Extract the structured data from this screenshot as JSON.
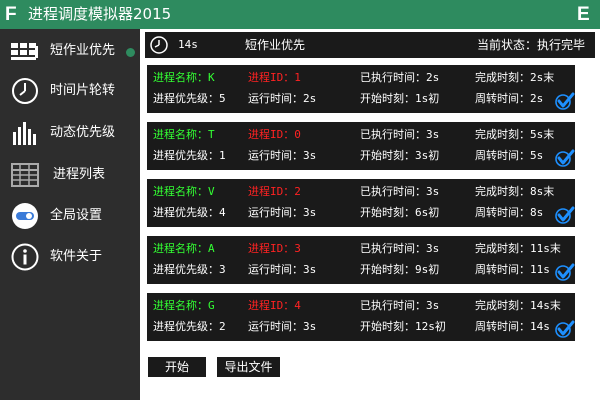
{
  "window": {
    "logo_letter": "F",
    "title": "进程调度模拟器2015",
    "corner_letter": "E"
  },
  "sidebar": {
    "items": [
      {
        "label": "短作业优先",
        "icon": "sjf-icon",
        "active": true
      },
      {
        "label": "时间片轮转",
        "icon": "clock-icon",
        "active": false
      },
      {
        "label": "动态优先级",
        "icon": "bar-chart-icon",
        "active": false
      },
      {
        "label": "进程列表",
        "icon": "table-icon",
        "active": false
      },
      {
        "label": "全局设置",
        "icon": "toggle-icon",
        "active": false
      },
      {
        "label": "软件关于",
        "icon": "info-icon",
        "active": false
      }
    ]
  },
  "status": {
    "time": "14s",
    "algorithm": "短作业优先",
    "state": "当前状态：执行完毕"
  },
  "labels": {
    "name": "进程名称：",
    "pid": "进程ID：",
    "executed": "已执行时间：",
    "finish": "完成时刻：",
    "priority": "进程优先级：",
    "runtime": "运行时间：",
    "start": "开始时刻：",
    "turnaround": "周转时间："
  },
  "processes": [
    {
      "name": "K",
      "pid": "1",
      "executed": "2s",
      "finish": "2s末",
      "priority": "5",
      "runtime": "2s",
      "start": "1s初",
      "turnaround": "2s",
      "done": true
    },
    {
      "name": "T",
      "pid": "0",
      "executed": "3s",
      "finish": "5s末",
      "priority": "1",
      "runtime": "3s",
      "start": "3s初",
      "turnaround": "5s",
      "done": true
    },
    {
      "name": "V",
      "pid": "2",
      "executed": "3s",
      "finish": "8s末",
      "priority": "4",
      "runtime": "3s",
      "start": "6s初",
      "turnaround": "8s",
      "done": true
    },
    {
      "name": "A",
      "pid": "3",
      "executed": "3s",
      "finish": "11s末",
      "priority": "3",
      "runtime": "3s",
      "start": "9s初",
      "turnaround": "11s",
      "done": true
    },
    {
      "name": "G",
      "pid": "4",
      "executed": "3s",
      "finish": "14s末",
      "priority": "2",
      "runtime": "3s",
      "start": "12s初",
      "turnaround": "14s",
      "done": true
    }
  ],
  "buttons": {
    "start": "开始",
    "export": "导出文件"
  },
  "colors": {
    "accent": "#2e8b5f",
    "card_bg": "#1a1a1a",
    "sidebar_bg": "#2d2d2d",
    "label_green": "#33ff33",
    "label_red": "#ff2222",
    "check_blue": "#1e90ff"
  }
}
